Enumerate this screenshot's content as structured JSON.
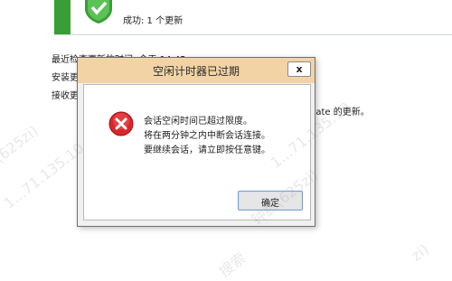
{
  "update_status": {
    "text": "成功: 1 个更新"
  },
  "info_lines": [
    "最近检查更新的时间:  今天 14:45",
    "安装更",
    "接收更"
  ],
  "info_tail": "date 的更新。",
  "dialog": {
    "title": "空闲计时器已过期",
    "close_symbol": "x",
    "message_lines": [
      "会话空闲时间已超过限度。",
      "将在两分钟之内中断会话连接。",
      "要继续会话，请立即按任意键。"
    ],
    "ok_label": "确定",
    "icon": "error-icon"
  },
  "watermark": {
    "texts": [
      "(625zi)",
      "1...71.135.10",
      "钟鹏(625zi)",
      "1...71.135.10",
      "搜索",
      "zi)"
    ]
  },
  "colors": {
    "titlebar": "#f2d3a6",
    "status_stripe": "#3a9e36",
    "error_red": "#d9262c"
  }
}
